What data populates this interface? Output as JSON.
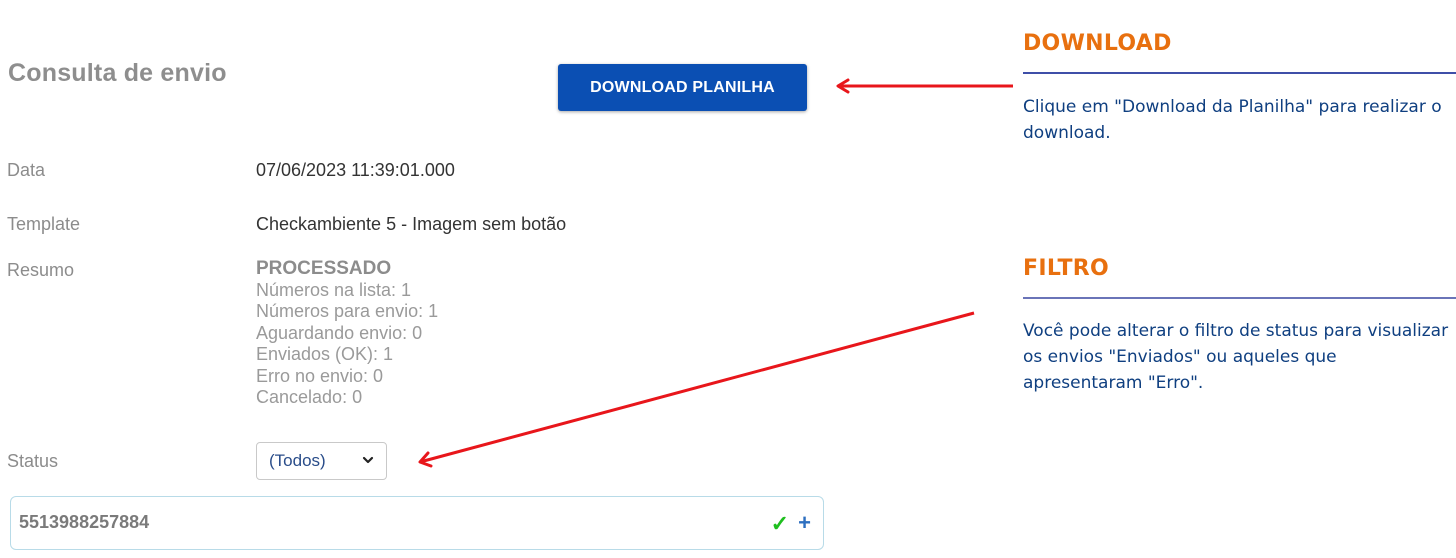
{
  "page": {
    "title": "Consulta de envio",
    "download_button": "DOWNLOAD PLANILHA"
  },
  "fields": {
    "data_label": "Data",
    "data_value": "07/06/2023 11:39:01.000",
    "template_label": "Template",
    "template_value": "Checkambiente 5 - Imagem sem botão",
    "resumo_label": "Resumo",
    "status_label": "Status"
  },
  "summary": {
    "status": "PROCESSADO",
    "lines": [
      "Números na lista: 1",
      "Números para envio: 1",
      "Aguardando envio: 0",
      "Enviados (OK): 1",
      "Erro no envio: 0",
      "Cancelado: 0"
    ]
  },
  "status_filter": {
    "selected": "(Todos)"
  },
  "records": [
    {
      "number": "5513988257884",
      "check_icon": "✓",
      "add_icon": "+"
    }
  ],
  "annotations": {
    "download": {
      "title": "DOWNLOAD",
      "text": "Clique em \"Download da Planilha\" para realizar o download."
    },
    "filtro": {
      "title": "FILTRO",
      "text": "Você pode alterar o filtro de status para visualizar os envios \"Enviados\" ou aqueles que apresentaram \"Erro\"."
    }
  },
  "colors": {
    "button": "#0b4fb3",
    "annotation_title": "#e8700f",
    "annotation_text": "#0f3f80",
    "arrow": "#e8161b",
    "check": "#1fbf1f",
    "plus": "#2d6fc0"
  }
}
